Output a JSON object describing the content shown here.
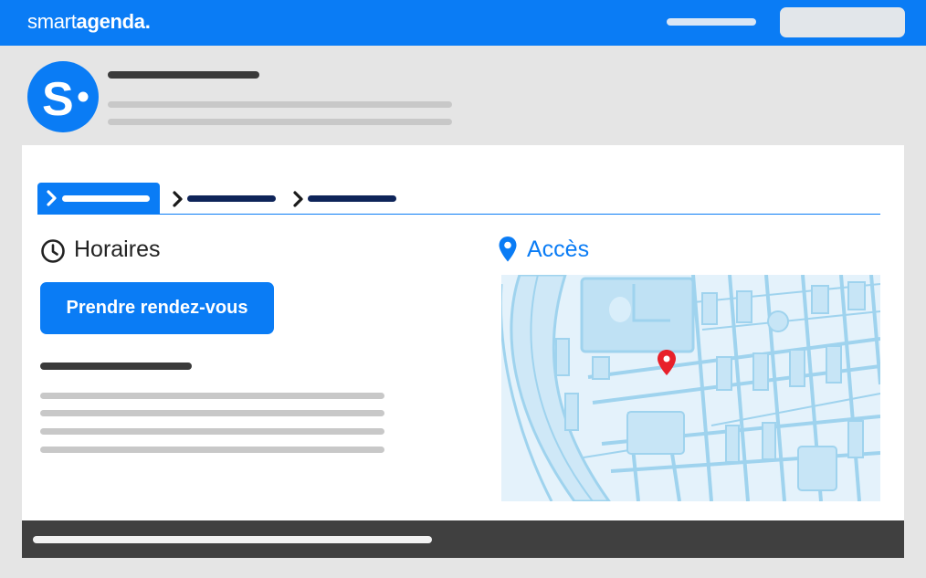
{
  "brand": {
    "prefix": "smart",
    "name": "agenda",
    "suffix": "."
  },
  "sections": {
    "hours_title": "Horaires",
    "access_title": "Accès"
  },
  "cta": {
    "label": "Prendre rendez-vous"
  },
  "map": {
    "marker_color": "#e8202a",
    "road_color": "#9fd3ee",
    "block_color": "#e4f2fb"
  },
  "colors": {
    "brand_blue": "#0a7cf5",
    "dark_navy": "#0e2459",
    "footer": "#404040",
    "placeholder": "#c8c8c8"
  },
  "icons": [
    "chevron-right-icon",
    "clock-icon",
    "map-pin-icon",
    "map-marker-icon"
  ]
}
